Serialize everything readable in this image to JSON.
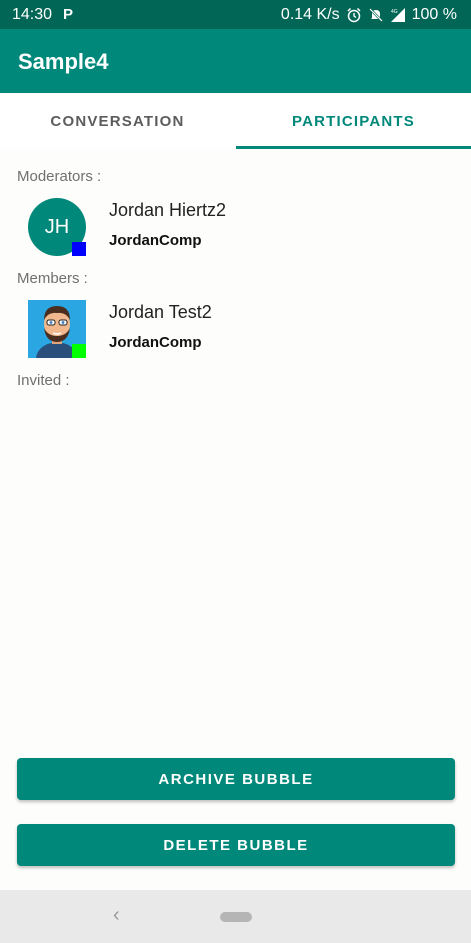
{
  "status_bar": {
    "time": "14:30",
    "app_icon": "P",
    "network_speed": "0.14 K/s",
    "battery": "100 %",
    "icons": [
      "alarm-icon",
      "mute-icon",
      "signal-icon"
    ]
  },
  "app_bar": {
    "title": "Sample4"
  },
  "tabs": [
    {
      "label": "CONVERSATION",
      "active": false
    },
    {
      "label": "PARTICIPANTS",
      "active": true
    }
  ],
  "moderators": {
    "label": "Moderators :",
    "items": [
      {
        "initials": "JH",
        "name": "Jordan Hiertz2",
        "company": "JordanComp",
        "presence_color": "#0000ff"
      }
    ]
  },
  "members": {
    "label": "Members :",
    "items": [
      {
        "name": "Jordan Test2",
        "company": "JordanComp",
        "presence_color": "#00ff00"
      }
    ]
  },
  "invited": {
    "label": "Invited :"
  },
  "buttons": {
    "archive": "ARCHIVE BUBBLE",
    "delete": "DELETE BUBBLE"
  },
  "colors": {
    "primary": "#00897a",
    "primary_dark": "#026656"
  }
}
